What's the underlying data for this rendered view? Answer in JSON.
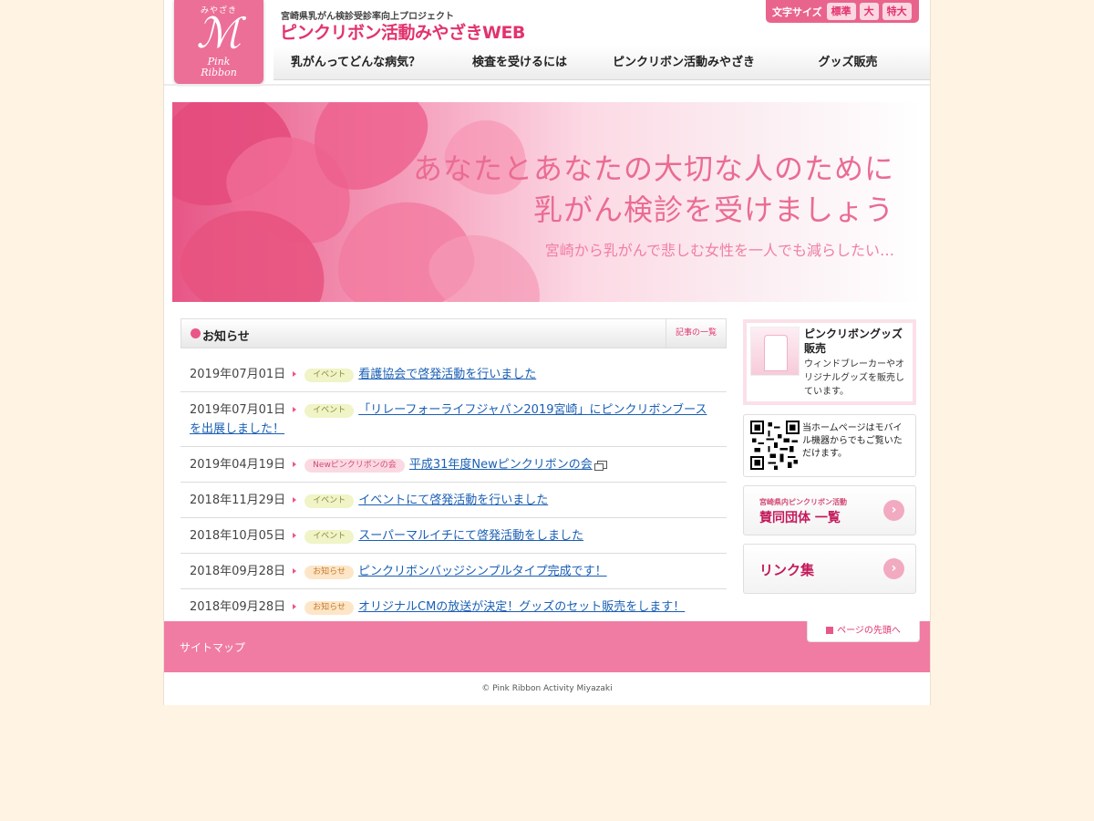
{
  "header": {
    "logo": {
      "kana": "みやざき",
      "mark": "ℳ",
      "line1": "Pink",
      "line2": "Ribbon"
    },
    "tagline": "宮崎県乳がん検診受診率向上プロジェクト",
    "site_title": "ピンクリボン活動みやざきWEB",
    "font_size": {
      "label": "文字サイズ",
      "options": [
        "標準",
        "大",
        "特大"
      ]
    },
    "nav": [
      "乳がんってどんな病気？",
      "検査を受けるには",
      "ピンクリボン活動みやざき",
      "グッズ販売"
    ]
  },
  "hero": {
    "catch_line1": "あなたとあなたの大切な人のために",
    "catch_line2": "乳がん検診を受けましょう",
    "sub": "宮崎から乳がんで悲しむ女性を一人でも減らしたい…"
  },
  "news": {
    "title": "お知らせ",
    "more": "記事の一覧",
    "items": [
      {
        "date": "2019年07月01日",
        "category": "イベント",
        "cat_type": "event",
        "title": "看護協会で啓発活動を行いました",
        "external": false
      },
      {
        "date": "2019年07月01日",
        "category": "イベント",
        "cat_type": "event",
        "title": "「リレーフォーライフジャパン2019宮崎」にピンクリボンブースを出展しました！",
        "external": false
      },
      {
        "date": "2019年04月19日",
        "category": "Newピンクリボンの会",
        "cat_type": "new",
        "title": "平成31年度Newピンクリボンの会",
        "external": true
      },
      {
        "date": "2018年11月29日",
        "category": "イベント",
        "cat_type": "event",
        "title": "イベントにて啓発活動を行いました",
        "external": false
      },
      {
        "date": "2018年10月05日",
        "category": "イベント",
        "cat_type": "event",
        "title": "スーパーマルイチにて啓発活動をしました",
        "external": false
      },
      {
        "date": "2018年09月28日",
        "category": "お知らせ",
        "cat_type": "info",
        "title": "ピンクリボンバッジシンプルタイプ完成です！",
        "external": false
      },
      {
        "date": "2018年09月28日",
        "category": "お知らせ",
        "cat_type": "info",
        "title": "オリジナルCMの放送が決定！グッズのセット販売をします！",
        "external": false
      }
    ]
  },
  "sidebar": {
    "goods": {
      "title_line1": "ピンクリボングッズ",
      "title_line2": "販売",
      "desc_lines": [
        "ウィンドブレーカーやオ",
        "リジナルグッズを販売し",
        "ています。"
      ]
    },
    "mobile": {
      "desc_lines": [
        "当ホームページはモバイ",
        "ル機器からでもご覧いた",
        "だけます。"
      ]
    },
    "supporters": {
      "small": "宮崎県内ピンクリボン活動",
      "big": "賛同団体 一覧"
    },
    "links": {
      "big": "リンク集"
    }
  },
  "footer": {
    "sitemap": "サイトマップ",
    "to_top": "ページの先頭へ",
    "copyright": "© Pink Ribbon Activity Miyazaki"
  },
  "colors": {
    "accent": "#e9578a",
    "footer": "#f07ca3",
    "background": "#fff4e3",
    "link": "#1a5fb4"
  }
}
